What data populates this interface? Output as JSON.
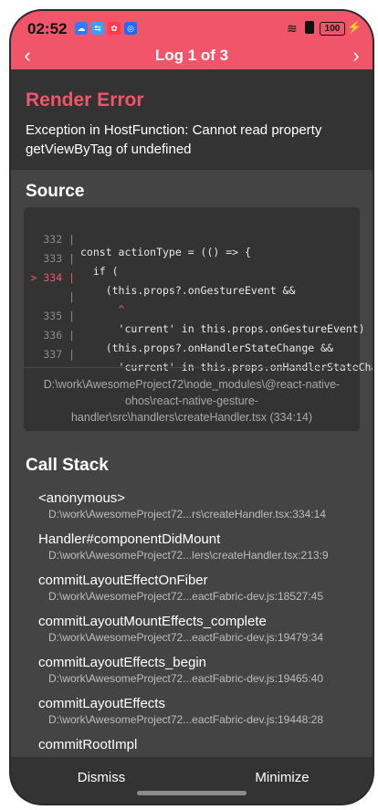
{
  "status_bar": {
    "time": "02:52",
    "battery": "100"
  },
  "nav": {
    "title": "Log 1 of 3",
    "prev_glyph": "‹",
    "next_glyph": "›"
  },
  "error": {
    "title": "Render Error",
    "message": "Exception in HostFunction: Cannot read property getViewByTag of undefined"
  },
  "source": {
    "title": "Source",
    "lines": [
      {
        "num": "332 |",
        "text": "const actionType = (() => {"
      },
      {
        "num": "333 |",
        "text": "  if ("
      },
      {
        "num": "> 334 |",
        "text": "    (this.props?.onGestureEvent &&"
      },
      {
        "num": "|",
        "text": "      ^"
      },
      {
        "num": "335 |",
        "text": "      'current' in this.props.onGestureEvent) ||"
      },
      {
        "num": "336 |",
        "text": "    (this.props?.onHandlerStateChange &&"
      },
      {
        "num": "337 |",
        "text": "      'current' in this.props.onHandlerStateChange)"
      }
    ],
    "path": "D:\\work\\AwesomeProject72\\node_modules\\@react-native-ohos\\react-native-gesture-handler\\src\\handlers\\createHandler.tsx (334:14)"
  },
  "call_stack": {
    "title": "Call Stack",
    "frames": [
      {
        "fn": "<anonymous>",
        "loc": "D:\\work\\AwesomeProject72...rs\\createHandler.tsx:334:14"
      },
      {
        "fn": "Handler#componentDidMount",
        "loc": "D:\\work\\AwesomeProject72...lers\\createHandler.tsx:213:9"
      },
      {
        "fn": "commitLayoutEffectOnFiber",
        "loc": "D:\\work\\AwesomeProject72...eactFabric-dev.js:18527:45"
      },
      {
        "fn": "commitLayoutMountEffects_complete",
        "loc": "D:\\work\\AwesomeProject72...eactFabric-dev.js:19479:34"
      },
      {
        "fn": "commitLayoutEffects_begin",
        "loc": "D:\\work\\AwesomeProject72...eactFabric-dev.js:19465:40"
      },
      {
        "fn": "commitLayoutEffects",
        "loc": "D:\\work\\AwesomeProject72...eactFabric-dev.js:19448:28"
      },
      {
        "fn": "commitRootImpl",
        "loc": ""
      }
    ]
  },
  "footer": {
    "dismiss_label": "Dismiss",
    "minimize_label": "Minimize"
  },
  "colors": {
    "accent": "#f0556a",
    "background": "#444444",
    "panel": "#333333"
  },
  "icons": [
    "cloud-icon",
    "usb-icon",
    "huawei-icon",
    "app-icon",
    "wifi-icon",
    "silent-icon",
    "battery-icon",
    "charging-icon"
  ]
}
